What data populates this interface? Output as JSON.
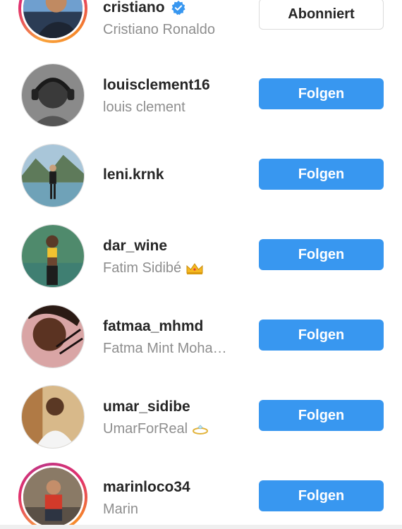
{
  "accounts": [
    {
      "username": "cristiano",
      "full_name": "Cristiano Ronaldo",
      "verified": true,
      "has_story": true,
      "button_label": "Abonniert",
      "button_state": "subscribed",
      "avatar_icon": "avatar-photo"
    },
    {
      "username": "louisclement16",
      "full_name": "louis clement",
      "verified": false,
      "has_story": false,
      "button_label": "Folgen",
      "button_state": "follow",
      "avatar_icon": "avatar-photo"
    },
    {
      "username": "leni.krnk",
      "full_name": "",
      "verified": false,
      "has_story": false,
      "button_label": "Folgen",
      "button_state": "follow",
      "avatar_icon": "avatar-photo"
    },
    {
      "username": "dar_wine",
      "full_name": "Fatim Sidibé",
      "full_name_emoji": "crown-emoji",
      "verified": false,
      "has_story": false,
      "button_label": "Folgen",
      "button_state": "follow",
      "avatar_icon": "avatar-photo"
    },
    {
      "username": "fatmaa_mhmd",
      "full_name": "Fatma Mint Moha…",
      "verified": false,
      "has_story": false,
      "button_label": "Folgen",
      "button_state": "follow",
      "avatar_icon": "avatar-photo"
    },
    {
      "username": "umar_sidibe",
      "full_name": "UmarForReal",
      "full_name_emoji": "ring-emoji",
      "verified": false,
      "has_story": false,
      "button_label": "Folgen",
      "button_state": "follow",
      "avatar_icon": "avatar-photo"
    },
    {
      "username": "marinloco34",
      "full_name": "Marin",
      "verified": false,
      "has_story": true,
      "button_label": "Folgen",
      "button_state": "follow",
      "avatar_icon": "avatar-photo"
    }
  ],
  "colors": {
    "follow_button": "#3897f0",
    "verified_badge": "#3897f0",
    "username_text": "#262626",
    "fullname_text": "#8e8e8e",
    "story_ring_start": "#f9a33c",
    "story_ring_end": "#c13584"
  }
}
